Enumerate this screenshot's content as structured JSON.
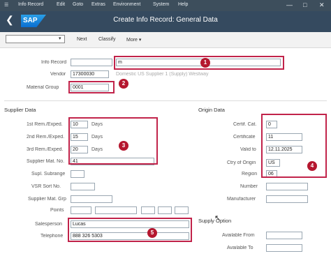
{
  "menubar": {
    "items": [
      "Info Record",
      "Edit",
      "Goto",
      "Extras",
      "Environment",
      "System",
      "Help"
    ],
    "win_controls": [
      "—",
      "□",
      "✕"
    ]
  },
  "titlebar": {
    "logo": "SAP",
    "title": "Create Info Record: General Data"
  },
  "toolbar": {
    "buttons": [
      "Next",
      "Classify",
      "More ▾"
    ]
  },
  "header": {
    "fields": [
      {
        "label": "Info Record",
        "value": ""
      },
      {
        "label": "Vendor",
        "value": "17300030"
      },
      {
        "label": "Material Group",
        "value": "0001"
      }
    ],
    "vendor_name": "Domestic US Supplier 1 (Supply) Westway",
    "description": "m"
  },
  "supplier_data": {
    "title": "Supplier Data",
    "reminders": [
      {
        "label": "1st Rem./Exped.",
        "value": "10",
        "unit": "Days"
      },
      {
        "label": "2nd Rem./Exped.",
        "value": "15",
        "unit": "Days"
      },
      {
        "label": "3rd Rem./Exped.",
        "value": "20",
        "unit": "Days"
      }
    ],
    "supplier_mat_no": {
      "label": "Supplier Mat. No.",
      "value": "41"
    },
    "other_labels": [
      "Supl. Subrange",
      "VSR Sort No.",
      "Supplier Mat. Grp",
      "Points",
      "Salesperson",
      "Telephone"
    ],
    "salesperson": "Lucas",
    "telephone": "888 326 5303"
  },
  "origin_data": {
    "title": "Origin Data",
    "fields": [
      {
        "label": "Certif. Cat.",
        "value": "0"
      },
      {
        "label": "Certificate",
        "value": "11"
      },
      {
        "label": "Valid to",
        "value": "12.11.2025"
      },
      {
        "label": "Ctry of Origin",
        "value": "US"
      },
      {
        "label": "Region",
        "value": "06"
      }
    ],
    "other_labels": [
      "Number",
      "Manufacturer"
    ]
  },
  "supply_option": {
    "title": "Supply Option",
    "labels": [
      "Available From",
      "Available To"
    ]
  },
  "annotations": [
    "1",
    "2",
    "3",
    "4",
    "5"
  ]
}
